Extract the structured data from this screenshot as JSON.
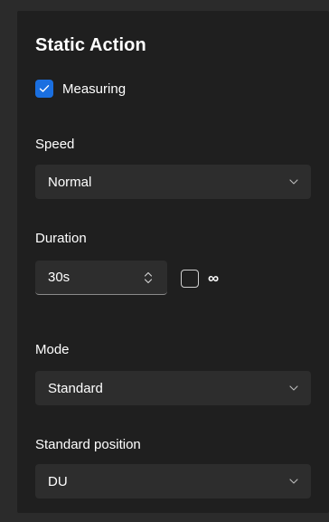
{
  "panel": {
    "title": "Static Action",
    "measuring": {
      "label": "Measuring",
      "checked": true,
      "check_icon": "checkmark-icon"
    },
    "speed": {
      "label": "Speed",
      "value": "Normal",
      "icon": "chevron-down-icon"
    },
    "duration": {
      "label": "Duration",
      "value": "30s",
      "spin_icon": "up-down-arrows-icon",
      "infinite": {
        "label": "∞",
        "checked": false
      }
    },
    "mode": {
      "label": "Mode",
      "value": "Standard",
      "icon": "chevron-down-icon"
    },
    "standard_position": {
      "label": "Standard position",
      "value": "DU",
      "icon": "chevron-down-icon"
    }
  },
  "colors": {
    "accent": "#1a6fe0",
    "panel_bg": "#1f1f1f",
    "control_bg": "#2d2d2d",
    "window_bg": "#2b2b2b"
  }
}
